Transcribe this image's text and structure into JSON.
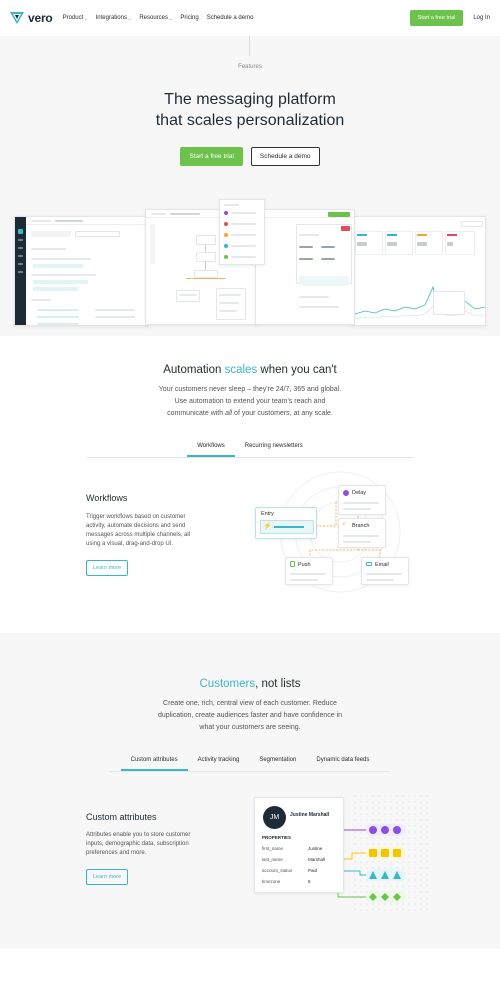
{
  "nav": {
    "logo_text": "vero",
    "links": [
      {
        "label": "Product",
        "has_menu": true
      },
      {
        "label": "Integrations",
        "has_menu": true
      },
      {
        "label": "Resources",
        "has_menu": true
      },
      {
        "label": "Pricing",
        "has_menu": false
      },
      {
        "label": "Schedule a demo",
        "has_menu": false
      }
    ],
    "chevron": "⌄",
    "cta_label": "Start a free trial",
    "login_label": "Log In"
  },
  "hero": {
    "eyebrow": "Features",
    "title_line1": "The messaging platform",
    "title_line2": "that scales personalization",
    "primary_button": "Start a free trial",
    "secondary_button": "Schedule a demo"
  },
  "automation": {
    "title_pre": "Automation ",
    "title_accent": "scales",
    "title_post": " when you can't",
    "body_line1": "Your customers never sleep – they're 24/7, 365 and global.",
    "body_line2": "Use automation to extend your team's reach and",
    "body_line3_pre": "communicate with ",
    "body_line3_em": "all",
    "body_line3_post": " of your customers, at any scale.",
    "tabs": [
      "Workflows",
      "Recurring newsletters"
    ],
    "active_tab": 0,
    "feature": {
      "title": "Workflows",
      "body": "Trigger workflows based on customer activity, automate decisions and send messages across multiple channels, all using a visual, drag-and-drop UI.",
      "button": "Learn more"
    },
    "diagram": {
      "entry_label": "Entry",
      "delay_label": "Delay",
      "branch_label": "Branch",
      "push_label": "Push",
      "email_label": "Email"
    }
  },
  "customers": {
    "title_accent": "Customers",
    "title_post": ", not lists",
    "body_line1": "Create one, rich, central view of each customer. Reduce",
    "body_line2": "duplication, create audiences faster and have confidence in",
    "body_line3": "what your customers are seeing.",
    "tabs": [
      "Custom attributes",
      "Activity tracking",
      "Segmentation",
      "Dynamic data feeds"
    ],
    "active_tab": 0,
    "feature": {
      "title": "Custom attributes",
      "body": "Attributes enable you to store customer inputs, demographic data, subscription preferences and more.",
      "button": "Learn more"
    },
    "profile": {
      "initials": "JM",
      "name": "Justine Marshall",
      "heading": "PROPERTIES",
      "props": [
        {
          "key": "first_name",
          "value": "Justine"
        },
        {
          "key": "last_name",
          "value": "Marshall"
        },
        {
          "key": "account_status",
          "value": "Paid"
        },
        {
          "key": "timezone",
          "value": "8"
        }
      ]
    }
  },
  "colors": {
    "brand_green": "#6cc24a",
    "accent_teal": "#3ab7c4",
    "dark_navy": "#1d2b36",
    "purple": "#8a4fe3",
    "yellow": "#f5c400",
    "green": "#6cc24a"
  }
}
